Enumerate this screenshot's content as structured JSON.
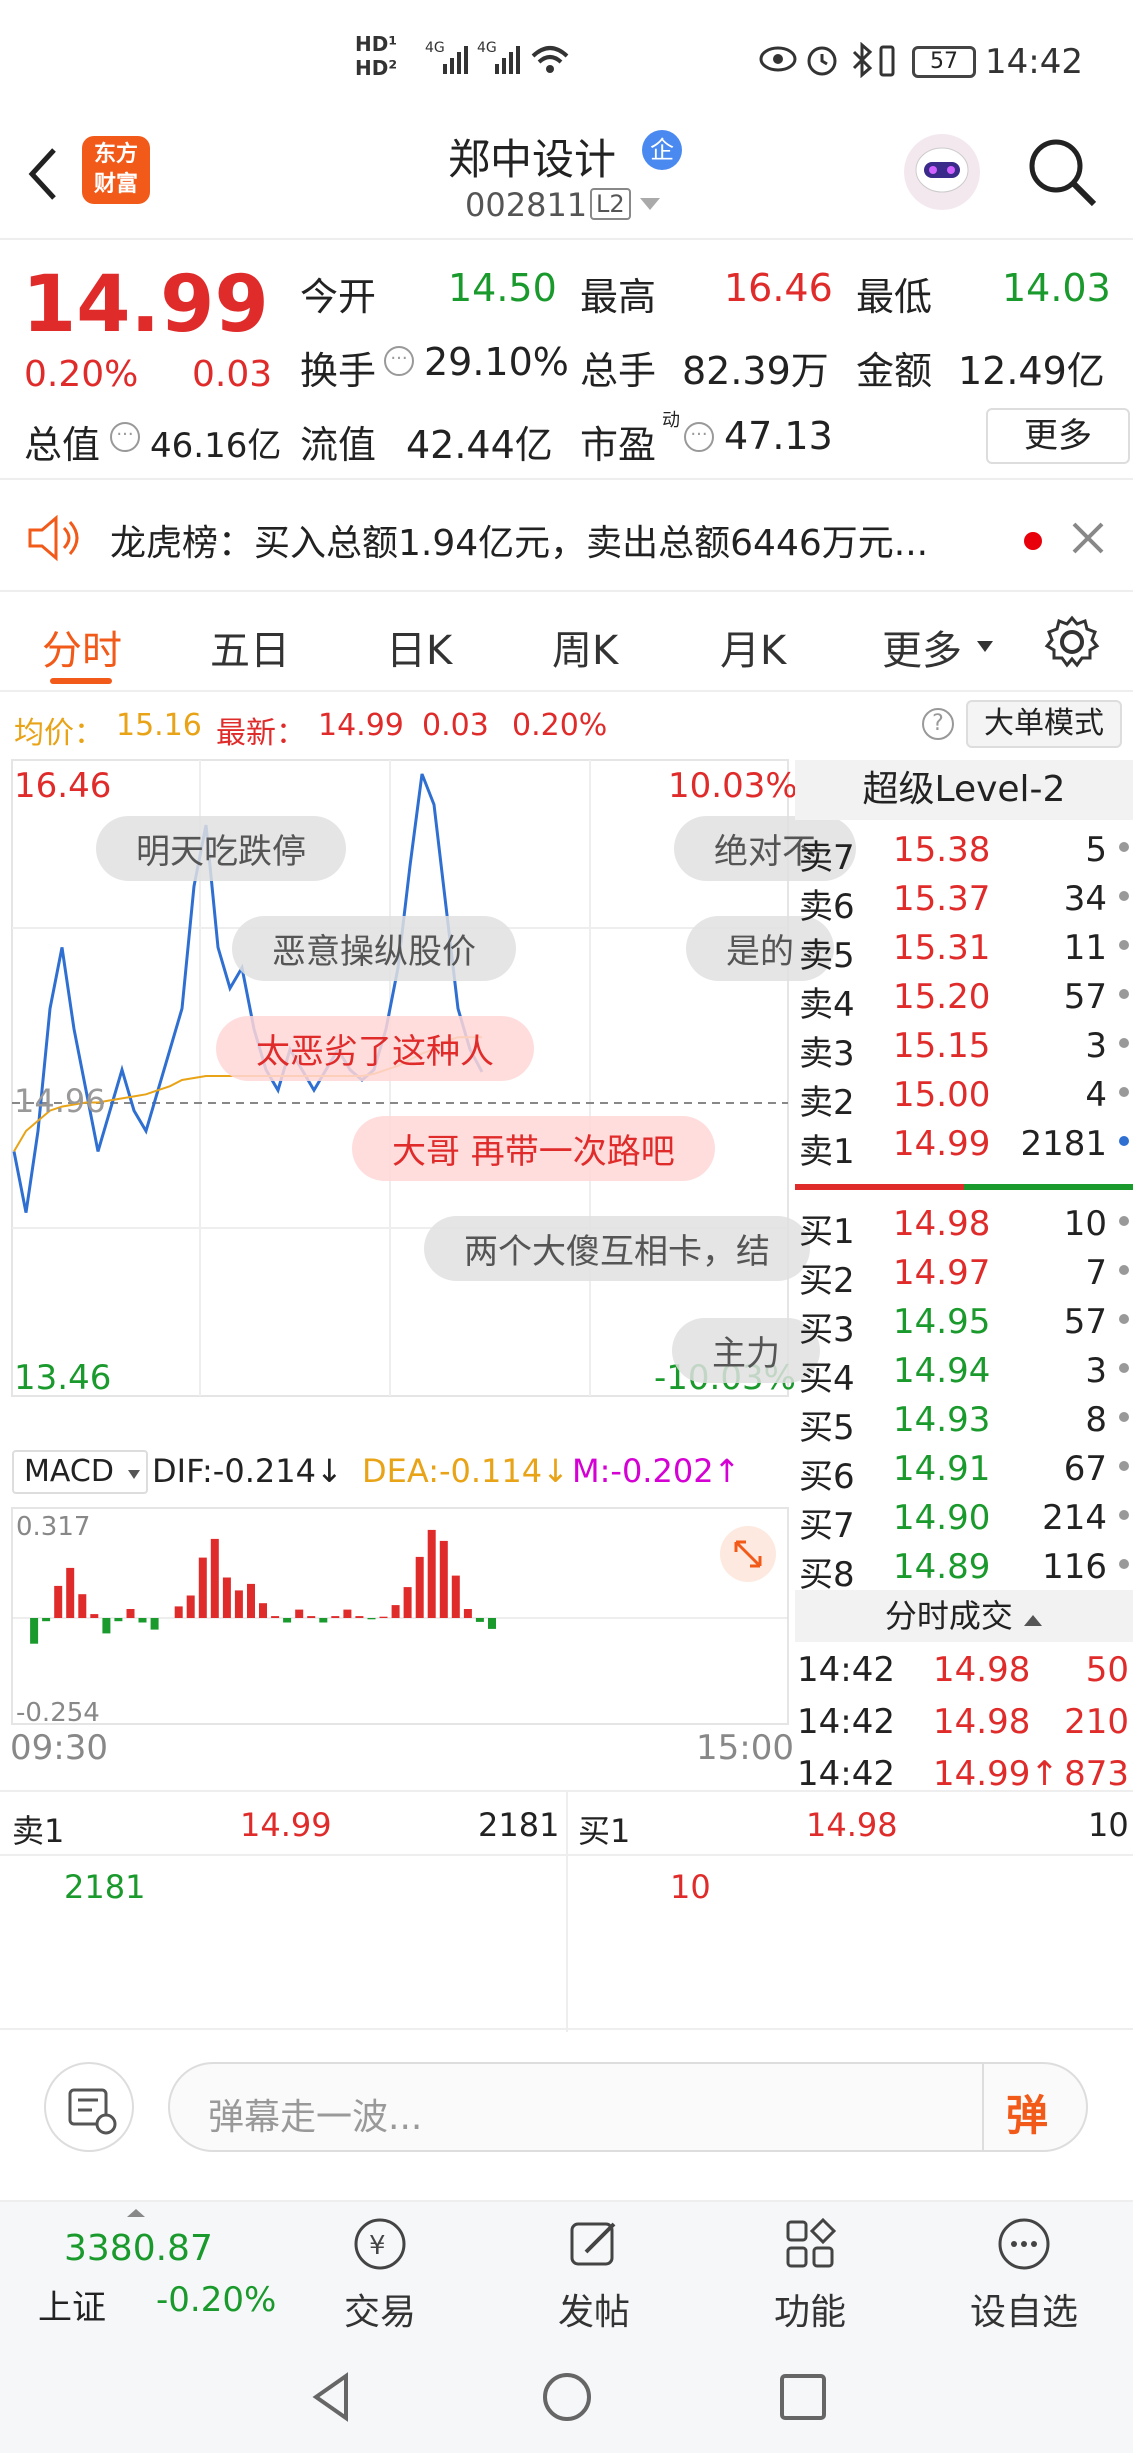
{
  "status_bar": {
    "time": "14:42",
    "battery": "57"
  },
  "header": {
    "logo_line1": "东方",
    "logo_line2": "财富",
    "stock_name": "郑中设计",
    "enterprise_badge": "企",
    "stock_code": "002811",
    "market_level": "L2"
  },
  "quote": {
    "price": "14.99",
    "change_pct": "0.20%",
    "change": "0.03",
    "open_label": "今开",
    "open": "14.50",
    "high_label": "最高",
    "high": "16.46",
    "low_label": "最低",
    "low": "14.03",
    "turnover_label": "换手",
    "turnover": "29.10%",
    "volume_label": "总手",
    "volume": "82.39万",
    "amount_label": "金额",
    "amount": "12.49亿",
    "mktcap_label": "总值",
    "mktcap": "46.16亿",
    "float_label": "流值",
    "float": "42.44亿",
    "pe_label": "市盈",
    "pe_sup": "动",
    "pe": "47.13",
    "more_button": "更多"
  },
  "notice": {
    "text": "龙虎榜：买入总额1.94亿元，卖出总额6446万元..."
  },
  "tabs": {
    "t1": "分时",
    "t2": "五日",
    "t3": "日K",
    "t4": "周K",
    "t5": "月K",
    "t6": "更多"
  },
  "infobar": {
    "avg_label": "均价：",
    "avg": "15.16",
    "last_label": "最新：",
    "last": "14.99",
    "last_change": "0.03",
    "last_pct": "0.20%",
    "big_order_button": "大单模式"
  },
  "chart": {
    "top_price": "16.46",
    "bottom_price": "13.46",
    "mid_price": "14.96",
    "top_pct": "10.03%",
    "bottom_pct": "-10.03%",
    "start_time": "09:30",
    "end_time": "15:00",
    "macd_select": "MACD",
    "dif": "DIF:-0.214↓",
    "dea": "DEA:-0.114↓",
    "m": "M:-0.202↑",
    "macd_top": "0.317",
    "macd_bottom": "-0.254"
  },
  "danmu": {
    "d1": "明天吃跌停",
    "d2": "绝对不",
    "d3": "恶意操纵股价",
    "d4": "是的",
    "d5": "太恶劣了这种人",
    "d6": "大哥 再带一次路吧",
    "d7": "两个大傻互相卡，结",
    "d8": "主力"
  },
  "chart_data": {
    "type": "line",
    "x_range": [
      "09:30",
      "15:00"
    ],
    "ylim": [
      13.46,
      16.46
    ],
    "series": [
      {
        "values": [
          14.6,
          14.3,
          14.7,
          15.3,
          15.6,
          15.2,
          14.9,
          14.6,
          14.8,
          15.0,
          14.8,
          14.7,
          14.9,
          15.1,
          15.3,
          15.9,
          16.2,
          15.6,
          15.4,
          15.5,
          15.2,
          15.0,
          14.9,
          15.1,
          15.0,
          14.9,
          15.0,
          15.1,
          15.0,
          14.95,
          15.0,
          15.2,
          15.5,
          16.0,
          16.45,
          16.3,
          15.8,
          15.3,
          15.1,
          14.99
        ]
      },
      {
        "values": [
          14.6,
          14.7,
          14.75,
          14.8,
          14.82,
          14.83,
          14.84,
          14.84,
          14.85,
          14.86,
          14.87,
          14.88,
          14.9,
          14.92,
          14.95,
          14.96,
          14.97,
          14.97,
          14.97,
          14.97,
          14.97,
          14.97,
          14.97,
          14.97,
          14.97,
          14.97,
          14.97,
          14.97,
          14.97,
          14.97,
          14.98,
          15.0,
          15.02,
          15.05,
          15.08,
          15.1,
          15.14,
          15.16,
          15.16,
          15.16
        ]
      }
    ]
  },
  "orderbook": {
    "title": "超级Level-2",
    "asks": [
      {
        "label": "卖7",
        "price": "15.38",
        "vol": "5"
      },
      {
        "label": "卖6",
        "price": "15.37",
        "vol": "34"
      },
      {
        "label": "卖5",
        "price": "15.31",
        "vol": "11"
      },
      {
        "label": "卖4",
        "price": "15.20",
        "vol": "57"
      },
      {
        "label": "卖3",
        "price": "15.15",
        "vol": "3"
      },
      {
        "label": "卖2",
        "price": "15.00",
        "vol": "4"
      },
      {
        "label": "卖1",
        "price": "14.99",
        "vol": "2181"
      }
    ],
    "bids": [
      {
        "label": "买1",
        "price": "14.98",
        "vol": "10"
      },
      {
        "label": "买2",
        "price": "14.97",
        "vol": "7"
      },
      {
        "label": "买3",
        "price": "14.95",
        "vol": "57"
      },
      {
        "label": "买4",
        "price": "14.94",
        "vol": "3"
      },
      {
        "label": "买5",
        "price": "14.93",
        "vol": "8"
      },
      {
        "label": "买6",
        "price": "14.91",
        "vol": "67"
      },
      {
        "label": "买7",
        "price": "14.90",
        "vol": "214"
      },
      {
        "label": "买8",
        "price": "14.89",
        "vol": "116"
      }
    ],
    "trades_title": "分时成交",
    "trades": [
      {
        "time": "14:42",
        "price": "14.98",
        "vol": "50"
      },
      {
        "time": "14:42",
        "price": "14.98",
        "vol": "210"
      },
      {
        "time": "14:42",
        "price": "14.99↑",
        "vol": "873"
      }
    ]
  },
  "level1": {
    "sell_label": "卖1",
    "sell_price": "14.99",
    "sell_vol": "2181",
    "sell_detail": "2181",
    "buy_label": "买1",
    "buy_price": "14.98",
    "buy_vol": "10",
    "buy_detail": "10"
  },
  "comment": {
    "placeholder": "弹幕走一波...",
    "send": "弹"
  },
  "bottom_nav": {
    "index_value": "3380.87",
    "index_name": "上证",
    "index_change": "-0.20%",
    "trade": "交易",
    "post": "发帖",
    "function": "功能",
    "watchlist": "设自选"
  }
}
